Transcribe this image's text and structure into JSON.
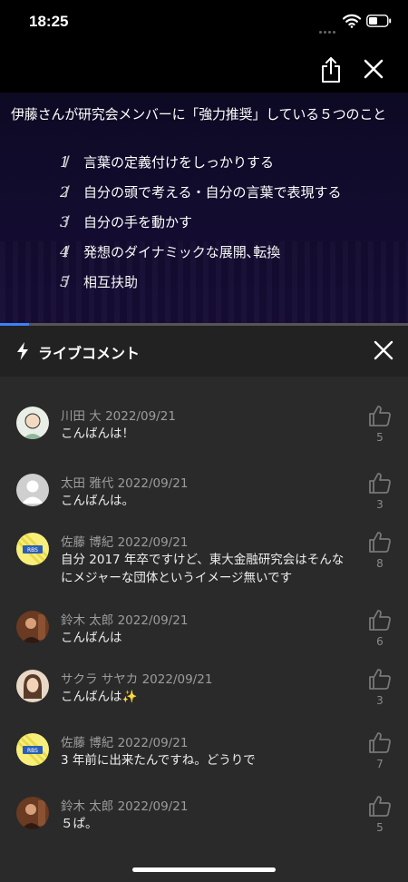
{
  "status_bar": {
    "time": "18:25"
  },
  "video": {
    "title": "伊藤さんが研究会メンバーに「強力推奨」している５つのこと",
    "items": [
      {
        "num": "1",
        "text": "言葉の定義付けをしっかりする"
      },
      {
        "num": "2",
        "text": "自分の頭で考える・自分の言葉で表現する"
      },
      {
        "num": "3",
        "text": "自分の手を動かす"
      },
      {
        "num": "4",
        "text": "発想のダイナミックな展開､転換"
      },
      {
        "num": "5",
        "text": "相互扶助"
      }
    ],
    "progress_fraction": 0.07
  },
  "live_comments": {
    "title": "ライブコメント",
    "comments": [
      {
        "author": "川田 大",
        "date": "2022/09/21",
        "text": "こんばんは！",
        "likes": "5",
        "avatar": "illustrated-face"
      },
      {
        "author": "太田 雅代",
        "date": "2022/09/21",
        "text": "こんばんは。",
        "likes": "3",
        "avatar": "default-person"
      },
      {
        "author": "佐藤 博紀",
        "date": "2022/09/21",
        "text": "自分 2017 年卒ですけど、東大金融研究会はそんなにメジャーな団体というイメージ無いです",
        "likes": "8",
        "avatar": "yellow-logo"
      },
      {
        "author": "鈴木 太郎",
        "date": "2022/09/21",
        "text": "こんばんは",
        "likes": "6",
        "avatar": "person-photo"
      },
      {
        "author": "サクラ サヤカ",
        "date": "2022/09/21",
        "text": "こんばんは✨",
        "likes": "3",
        "avatar": "woman-photo"
      },
      {
        "author": "佐藤 博紀",
        "date": "2022/09/21",
        "text": "3 年前に出来たんですね。どうりで",
        "likes": "7",
        "avatar": "yellow-logo"
      },
      {
        "author": "鈴木 太郎",
        "date": "2022/09/21",
        "text": "５ぱ。",
        "likes": "5",
        "avatar": "person-photo"
      }
    ]
  },
  "colors": {
    "accent": "#3b82f6",
    "background": "#2a2a2a"
  }
}
